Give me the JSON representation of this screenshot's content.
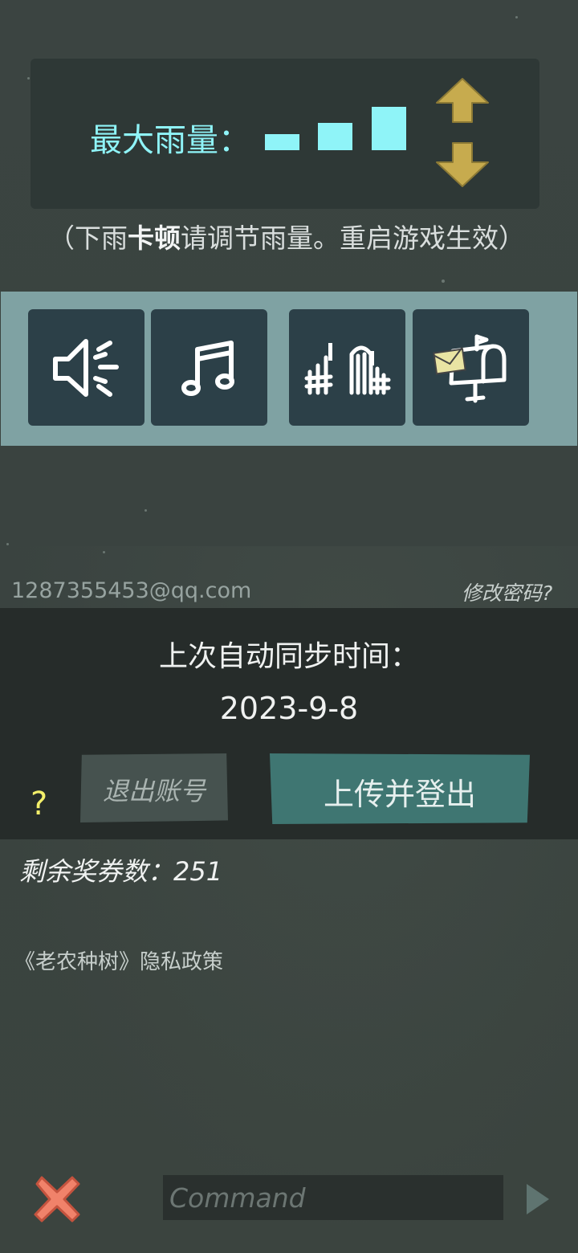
{
  "rain": {
    "label": "最大雨量：",
    "level": 3,
    "max_level": 3,
    "bar_color": "#8ff4f8",
    "up_icon": "arrow-up-icon",
    "down_icon": "arrow-down-icon"
  },
  "hint": {
    "before": "（下雨",
    "bold": "卡顿",
    "after": "请调节雨量。重启游戏生效）"
  },
  "toolbar": {
    "items": [
      {
        "name": "sound",
        "icon": "speaker-icon"
      },
      {
        "name": "music",
        "icon": "music-note-icon"
      },
      {
        "name": "fence",
        "icon": "fence-icon"
      },
      {
        "name": "mail",
        "icon": "mailbox-icon"
      }
    ]
  },
  "account": {
    "email": "1287355453@qq.com",
    "change_password": "修改密码?"
  },
  "sync": {
    "title": "上次自动同步时间：",
    "date": "2023-9-8",
    "logout_label": "退出账号",
    "upload_label": "上传并登出",
    "help": "?"
  },
  "tickets": {
    "label": "剩余奖券数：",
    "count": "251"
  },
  "privacy": "《老农种树》隐私政策",
  "command": {
    "placeholder": "Command",
    "value": ""
  },
  "colors": {
    "accent": "#8ff4f8",
    "arrow": "#c7ab4e",
    "close": "#f0826a",
    "upload_button": "#3f7672"
  }
}
